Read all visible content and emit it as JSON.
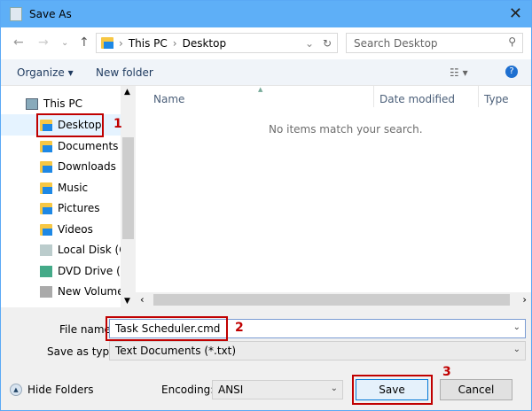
{
  "window": {
    "title": "Save As"
  },
  "address": {
    "crumbs": [
      "This PC",
      "Desktop"
    ],
    "search_placeholder": "Search Desktop"
  },
  "toolbar": {
    "organize": "Organize ▾",
    "new_folder": "New folder"
  },
  "tree": {
    "root": "This PC",
    "items": [
      "Desktop",
      "Documents",
      "Downloads",
      "Music",
      "Pictures",
      "Videos",
      "Local Disk (C:",
      "DVD Drive (D:",
      "New Volume ("
    ]
  },
  "list": {
    "columns": [
      "Name",
      "Date modified",
      "Type"
    ],
    "empty_text": "No items match your search."
  },
  "form": {
    "file_name_label": "File name:",
    "file_name": "Task Scheduler.cmd",
    "type_label": "Save as type:",
    "type_value": "Text Documents (*.txt)",
    "encoding_label": "Encoding:",
    "encoding_value": "ANSI"
  },
  "buttons": {
    "hide_folders": "Hide Folders",
    "save": "Save",
    "cancel": "Cancel"
  },
  "annotations": [
    "1",
    "2",
    "3"
  ]
}
